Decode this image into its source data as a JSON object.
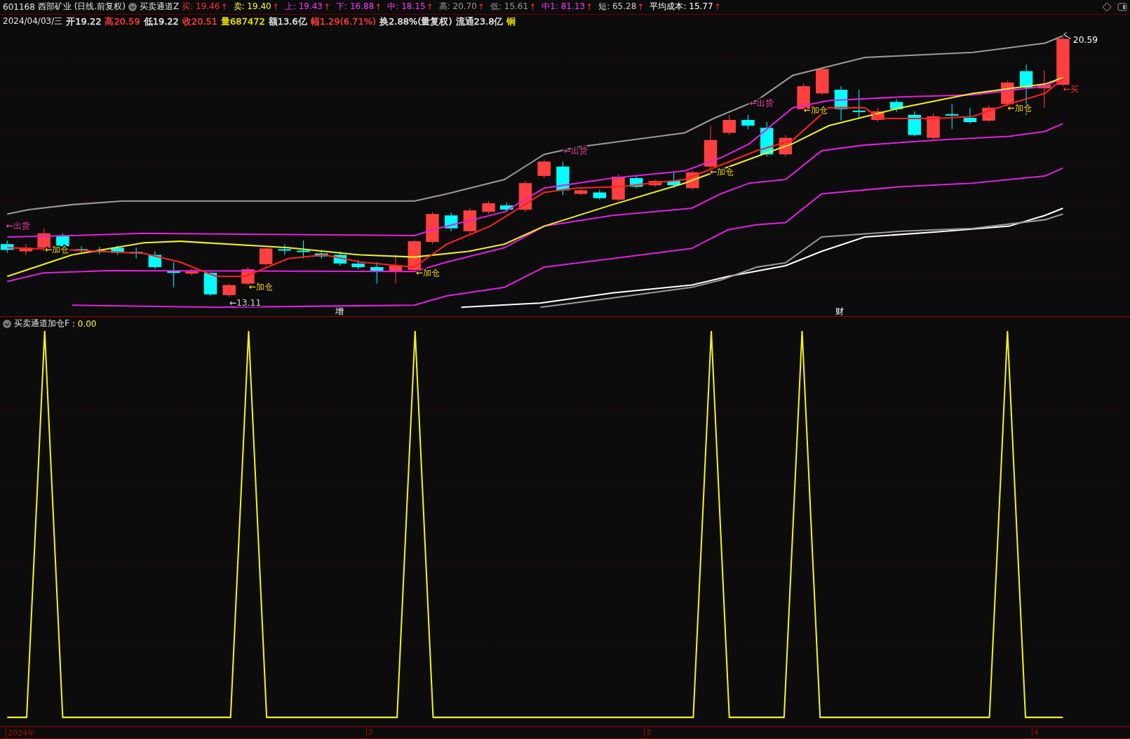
{
  "quote_header": {
    "code": "601168",
    "name": "西部矿业",
    "period": "(日线.前复权)",
    "indicator": "买卖通道Z",
    "items": [
      {
        "label": "买:",
        "value": "19.46",
        "color": "#ff3030",
        "arrow": "↑"
      },
      {
        "label": "卖:",
        "value": "19.40",
        "color": "#ffff33",
        "arrow": "↑"
      },
      {
        "label": "上:",
        "value": "19.43",
        "color": "#ff33ff",
        "arrow": "↑"
      },
      {
        "label": "下:",
        "value": "16.88",
        "color": "#ff33ff",
        "arrow": "↑"
      },
      {
        "label": "中:",
        "value": "18.15",
        "color": "#ff33ff",
        "arrow": "↑"
      },
      {
        "label": "高:",
        "value": "20.70",
        "color": "#9a9a9a",
        "arrow": "↑"
      },
      {
        "label": "低:",
        "value": "15.61",
        "color": "#9a9a9a",
        "arrow": "↑"
      },
      {
        "label": "中1:",
        "value": "81.13",
        "color": "#ff33ff",
        "arrow": "↑"
      },
      {
        "label": "短:",
        "value": "65.28",
        "color": "#cccccc",
        "arrow": "↑"
      },
      {
        "label": "平均成本:",
        "value": "15.77",
        "color": "#ffffff",
        "arrow": "↑"
      }
    ]
  },
  "quote_detail": {
    "date": "2024/04/03/三",
    "items": [
      {
        "text": "开19.22",
        "color": "#e6e6e6"
      },
      {
        "text": "高20.59",
        "color": "#ff3c3c"
      },
      {
        "text": "低19.22",
        "color": "#e6e6e6"
      },
      {
        "text": "收20.51",
        "color": "#ff3c3c"
      },
      {
        "text": "量687472",
        "color": "#e6e600"
      },
      {
        "text": "额13.6亿",
        "color": "#e6e6e6"
      },
      {
        "text": "幅1.29(6.71%)",
        "color": "#ff3c3c"
      },
      {
        "text": "换2.88%(量复权)",
        "color": "#e6e6e6"
      },
      {
        "text": "流通23.8亿",
        "color": "#e6e6e6"
      },
      {
        "text": "铜",
        "color": "#e6e600"
      }
    ]
  },
  "price_chart": {
    "high_label": "20.59",
    "annotations": [
      {
        "text": "←出货",
        "kind": "sell"
      },
      {
        "text": "←加仓",
        "kind": "add"
      },
      {
        "text": "←13.11",
        "kind": "low"
      },
      {
        "text": "←加仓",
        "kind": "add"
      },
      {
        "text": "←加仓",
        "kind": "add"
      },
      {
        "text": "←出货",
        "kind": "sell"
      },
      {
        "text": "←加仓",
        "kind": "add"
      },
      {
        "text": "←出货",
        "kind": "sell"
      },
      {
        "text": "←加仓",
        "kind": "add"
      },
      {
        "text": "←加仓",
        "kind": "add"
      },
      {
        "text": "←买",
        "kind": "buy"
      }
    ],
    "events": [
      "增",
      "财"
    ]
  },
  "indicator_panel": {
    "title": "买卖通道加仓F",
    "value": ": 0.00"
  },
  "time_axis": [
    "2024年",
    "2",
    "3",
    "4"
  ]
}
